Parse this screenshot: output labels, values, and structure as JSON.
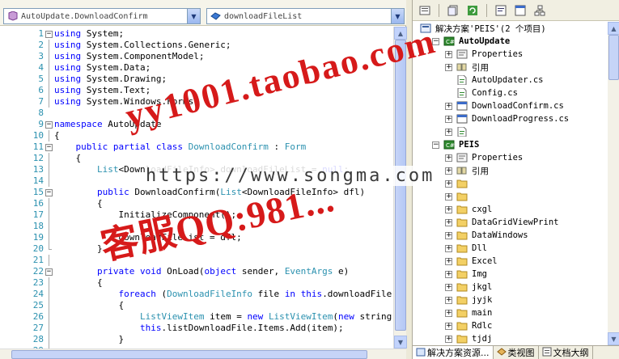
{
  "editor": {
    "class_combo": "AutoUpdate.DownloadConfirm",
    "member_combo": "downloadFileList",
    "lines": [
      {
        "n": "1",
        "fold": "minus",
        "segs": [
          {
            "t": "using",
            "c": "kw"
          },
          {
            "t": " System;"
          }
        ]
      },
      {
        "n": "2",
        "fold": "guide",
        "segs": [
          {
            "t": "using",
            "c": "kw"
          },
          {
            "t": " System.Collections.Generic;"
          }
        ]
      },
      {
        "n": "3",
        "fold": "guide",
        "segs": [
          {
            "t": "using",
            "c": "kw"
          },
          {
            "t": " System.ComponentModel;"
          }
        ]
      },
      {
        "n": "4",
        "fold": "guide",
        "segs": [
          {
            "t": "using",
            "c": "kw"
          },
          {
            "t": " System.Data;"
          }
        ]
      },
      {
        "n": "5",
        "fold": "guide",
        "segs": [
          {
            "t": "using",
            "c": "kw"
          },
          {
            "t": " System.Drawing;"
          }
        ]
      },
      {
        "n": "6",
        "fold": "guide",
        "segs": [
          {
            "t": "using",
            "c": "kw"
          },
          {
            "t": " System.Text;"
          }
        ]
      },
      {
        "n": "7",
        "fold": "guide",
        "segs": [
          {
            "t": "using",
            "c": "kw"
          },
          {
            "t": " System.Windows.Forms;"
          }
        ]
      },
      {
        "n": "8",
        "fold": "",
        "segs": []
      },
      {
        "n": "9",
        "fold": "minus",
        "segs": [
          {
            "t": "namespace",
            "c": "kw"
          },
          {
            "t": " AutoUpdate"
          }
        ]
      },
      {
        "n": "10",
        "fold": "guide",
        "segs": [
          {
            "t": "{"
          }
        ]
      },
      {
        "n": "11",
        "fold": "minus",
        "segs": [
          {
            "t": "    "
          },
          {
            "t": "public partial class",
            "c": "kw"
          },
          {
            "t": " "
          },
          {
            "t": "DownloadConfirm",
            "c": "ty"
          },
          {
            "t": " : "
          },
          {
            "t": "Form",
            "c": "ty"
          }
        ]
      },
      {
        "n": "12",
        "fold": "guide",
        "segs": [
          {
            "t": "    {"
          }
        ]
      },
      {
        "n": "13",
        "fold": "guide",
        "segs": [
          {
            "t": "        "
          },
          {
            "t": "List",
            "c": "ty"
          },
          {
            "t": "<DownloadFileInfo> downloadFileList = "
          },
          {
            "t": "null",
            "c": "kw"
          },
          {
            "t": ";"
          }
        ]
      },
      {
        "n": "14",
        "fold": "guide",
        "segs": []
      },
      {
        "n": "15",
        "fold": "minus",
        "segs": [
          {
            "t": "        "
          },
          {
            "t": "public",
            "c": "kw"
          },
          {
            "t": " DownloadConfirm("
          },
          {
            "t": "List",
            "c": "ty"
          },
          {
            "t": "<DownloadFileInfo> dfl)"
          }
        ]
      },
      {
        "n": "16",
        "fold": "guide",
        "segs": [
          {
            "t": "        {"
          }
        ]
      },
      {
        "n": "17",
        "fold": "guide",
        "segs": [
          {
            "t": "            InitializeComponent();"
          }
        ]
      },
      {
        "n": "18",
        "fold": "guide",
        "segs": []
      },
      {
        "n": "19",
        "fold": "guide",
        "segs": [
          {
            "t": "            downloadFileList = dfl;"
          }
        ]
      },
      {
        "n": "20",
        "fold": "end",
        "segs": [
          {
            "t": "        }"
          }
        ]
      },
      {
        "n": "21",
        "fold": "guide",
        "segs": []
      },
      {
        "n": "22",
        "fold": "minus",
        "segs": [
          {
            "t": "        "
          },
          {
            "t": "private void",
            "c": "kw"
          },
          {
            "t": " OnLoad("
          },
          {
            "t": "object",
            "c": "kw"
          },
          {
            "t": " sender, "
          },
          {
            "t": "EventArgs",
            "c": "ty"
          },
          {
            "t": " e)"
          }
        ]
      },
      {
        "n": "23",
        "fold": "guide",
        "segs": [
          {
            "t": "        {"
          }
        ]
      },
      {
        "n": "24",
        "fold": "guide",
        "segs": [
          {
            "t": "            "
          },
          {
            "t": "foreach",
            "c": "kw"
          },
          {
            "t": " ("
          },
          {
            "t": "DownloadFileInfo",
            "c": "ty"
          },
          {
            "t": " file "
          },
          {
            "t": "in",
            "c": "kw"
          },
          {
            "t": " "
          },
          {
            "t": "this",
            "c": "kw"
          },
          {
            "t": ".downloadFileList)"
          }
        ]
      },
      {
        "n": "25",
        "fold": "guide",
        "segs": [
          {
            "t": "            {"
          }
        ]
      },
      {
        "n": "26",
        "fold": "guide",
        "segs": [
          {
            "t": "                "
          },
          {
            "t": "ListViewItem",
            "c": "ty"
          },
          {
            "t": " item = "
          },
          {
            "t": "new",
            "c": "kw"
          },
          {
            "t": " "
          },
          {
            "t": "ListViewItem",
            "c": "ty"
          },
          {
            "t": "("
          },
          {
            "t": "new",
            "c": "kw"
          },
          {
            "t": " string[] { file.FileName });"
          }
        ]
      },
      {
        "n": "27",
        "fold": "guide",
        "segs": [
          {
            "t": "                "
          },
          {
            "t": "this",
            "c": "kw"
          },
          {
            "t": ".listDownloadFile.Items.Add(item);"
          }
        ]
      },
      {
        "n": "28",
        "fold": "guide",
        "segs": [
          {
            "t": "            }"
          }
        ]
      },
      {
        "n": "29",
        "fold": "guide",
        "segs": []
      }
    ]
  },
  "explorer": {
    "toolbar": [
      "properties-icon",
      "show-all-files-icon",
      "refresh-icon",
      "view-code-icon",
      "view-designer-icon",
      "class-diagram-icon"
    ],
    "tree": [
      {
        "label": "解决方案'PEIS'(2 个项目)",
        "indent": 0,
        "exp": "",
        "icon": "solution",
        "bold": false
      },
      {
        "label": "AutoUpdate",
        "indent": 1,
        "exp": "minus",
        "icon": "csproj",
        "bold": true
      },
      {
        "label": "Properties",
        "indent": 2,
        "exp": "plus",
        "icon": "properties",
        "bold": false
      },
      {
        "label": "引用",
        "indent": 2,
        "exp": "plus",
        "icon": "references",
        "bold": false
      },
      {
        "label": "AutoUpdater.cs",
        "indent": 2,
        "exp": "",
        "icon": "cs",
        "bold": false
      },
      {
        "label": "Config.cs",
        "indent": 2,
        "exp": "",
        "icon": "cs",
        "bold": false
      },
      {
        "label": "DownloadConfirm.cs",
        "indent": 2,
        "exp": "plus",
        "icon": "form",
        "bold": false
      },
      {
        "label": "DownloadProgress.cs",
        "indent": 2,
        "exp": "plus",
        "icon": "form",
        "bold": false
      },
      {
        "label": "",
        "indent": 2,
        "exp": "plus",
        "icon": "cs",
        "bold": false
      },
      {
        "label": "PEIS",
        "indent": 1,
        "exp": "minus",
        "icon": "csproj",
        "bold": true
      },
      {
        "label": "Properties",
        "indent": 2,
        "exp": "plus",
        "icon": "properties",
        "bold": false
      },
      {
        "label": "引用",
        "indent": 2,
        "exp": "plus",
        "icon": "references",
        "bold": false
      },
      {
        "label": "",
        "indent": 2,
        "exp": "plus",
        "icon": "folder",
        "bold": false
      },
      {
        "label": "",
        "indent": 2,
        "exp": "plus",
        "icon": "folder",
        "bold": false
      },
      {
        "label": "cxgl",
        "indent": 2,
        "exp": "plus",
        "icon": "folder",
        "bold": false
      },
      {
        "label": "DataGridViewPrint",
        "indent": 2,
        "exp": "plus",
        "icon": "folder",
        "bold": false
      },
      {
        "label": "DataWindows",
        "indent": 2,
        "exp": "plus",
        "icon": "folder",
        "bold": false
      },
      {
        "label": "Dll",
        "indent": 2,
        "exp": "plus",
        "icon": "folder",
        "bold": false
      },
      {
        "label": "Excel",
        "indent": 2,
        "exp": "plus",
        "icon": "folder",
        "bold": false
      },
      {
        "label": "Img",
        "indent": 2,
        "exp": "plus",
        "icon": "folder",
        "bold": false
      },
      {
        "label": "jkgl",
        "indent": 2,
        "exp": "plus",
        "icon": "folder",
        "bold": false
      },
      {
        "label": "jyjk",
        "indent": 2,
        "exp": "plus",
        "icon": "folder",
        "bold": false
      },
      {
        "label": "main",
        "indent": 2,
        "exp": "plus",
        "icon": "folder",
        "bold": false
      },
      {
        "label": "Rdlc",
        "indent": 2,
        "exp": "plus",
        "icon": "folder",
        "bold": false
      },
      {
        "label": "tjdj",
        "indent": 2,
        "exp": "plus",
        "icon": "folder",
        "bold": false
      }
    ],
    "tabs": [
      {
        "label": "解决方案资源...",
        "icon": "solution",
        "active": true
      },
      {
        "label": "类视图",
        "icon": "class-view",
        "active": false
      },
      {
        "label": "文档大纲",
        "icon": "outline",
        "active": false
      }
    ]
  },
  "watermark": {
    "line1": "yy1001.taobao.com",
    "line2": "https://www.songma.com",
    "line3": "客服QQ:981..."
  },
  "colors": {
    "keyword": "#0000ff",
    "type": "#2b91af",
    "watermark": "#d61a1a"
  }
}
